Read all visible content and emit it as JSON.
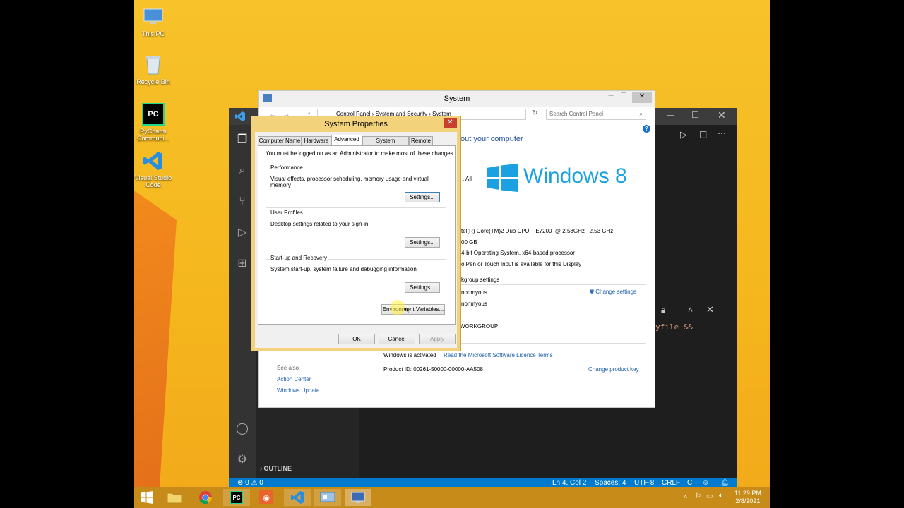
{
  "desktop_icons": [
    {
      "name": "this-pc",
      "label": "This PC"
    },
    {
      "name": "recycle-bin",
      "label": "Recycle Bin"
    },
    {
      "name": "pycharm",
      "label": "PyCharm Communi..."
    },
    {
      "name": "vscode",
      "label": "Visual Studio Code"
    }
  ],
  "vscode": {
    "outline_label": "OUTLINE",
    "code_fragment": "yfile &&",
    "status": {
      "problems": "⊗ 0 ⚠ 0",
      "position": "Ln 4, Col 2",
      "spaces": "Spaces: 4",
      "encoding": "UTF-8",
      "eol": "CRLF",
      "language": "C"
    }
  },
  "system_window": {
    "title": "System",
    "breadcrumb": [
      "Control Panel",
      "System and Security",
      "System"
    ],
    "search_placeholder": "Search Control Panel",
    "heading": "out your computer",
    "edition_fragment": ". All",
    "windows_logo_text": "Windows 8",
    "specs": [
      "tel(R) Core(TM)2 Duo CPU    E7200  @ 2.53GHz   2.53 GHz",
      "00 GB",
      "4-bit Operating System, x64-based processor",
      "o Pen or Touch Input is available for this Display"
    ],
    "workgroup_heading": "kgroup settings",
    "change_settings": "Change settings",
    "computer_name": "nonmyous",
    "full_name": "nonmyous",
    "workgroup": "WORKGROUP",
    "activation_status": "Windows is activated",
    "licence_link": "Read the Microsoft Software Licence Terms",
    "product_id": "Product ID:  00261-50000-00000-AA508",
    "change_key": "Change product key",
    "see_also_label": "See also",
    "see_also_links": [
      "Action Center",
      "Windows Update"
    ]
  },
  "system_properties": {
    "title": "System Properties",
    "close_label": "✕",
    "tabs": [
      "Computer Name",
      "Hardware",
      "Advanced",
      "System Protection",
      "Remote"
    ],
    "active_tab": "Advanced",
    "admin_note": "You must be logged on as an Administrator to make most of these changes.",
    "groups": [
      {
        "label": "Performance",
        "desc": "Visual effects, processor scheduling, memory usage and virtual memory",
        "button": "Settings..."
      },
      {
        "label": "User Profiles",
        "desc": "Desktop settings related to your sign-in",
        "button": "Settings..."
      },
      {
        "label": "Start-up and Recovery",
        "desc": "System start-up, system failure and debugging information",
        "button": "Settings..."
      }
    ],
    "env_button": "Environment Variables...",
    "ok": "OK",
    "cancel": "Cancel",
    "apply": "Apply"
  },
  "taskbar": {
    "clock_time": "11:29 PM",
    "clock_date": "2/8/2021"
  },
  "colors": {
    "desktop": "#f5b61d",
    "dialog_frame": "#f2d37c",
    "vscode_status": "#007acc",
    "link": "#1e5fae"
  }
}
